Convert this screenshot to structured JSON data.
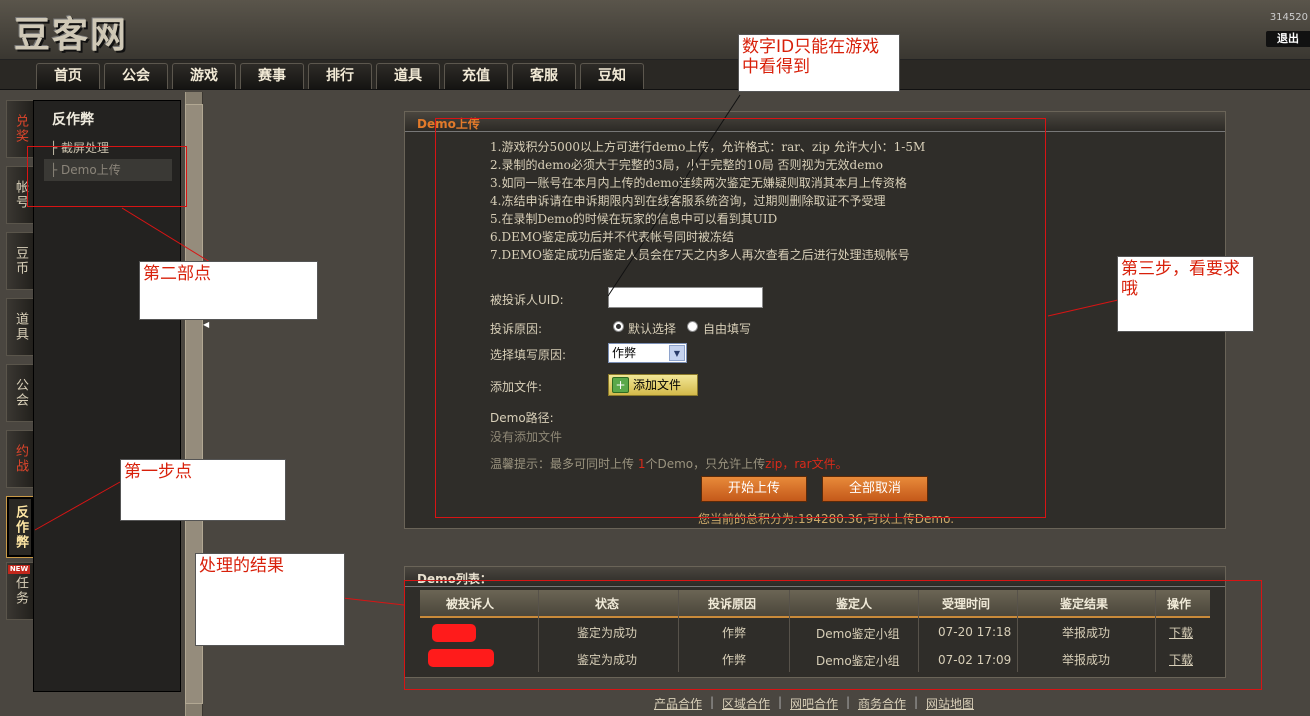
{
  "header": {
    "logo": "豆客网",
    "user_id_fragment": "314520",
    "logout_label": "退出"
  },
  "nav": {
    "items": [
      "首页",
      "公会",
      "游戏",
      "赛事",
      "排行",
      "道具",
      "充值",
      "客服",
      "豆知"
    ]
  },
  "left_tabs": {
    "items": [
      "兑奖",
      "帐号",
      "豆币",
      "道具",
      "公会",
      "约战",
      "反作弊",
      "任务"
    ],
    "new_badge": "NEW"
  },
  "side_panel": {
    "title": "反作弊",
    "links": [
      "截屏处理",
      "Demo上传"
    ]
  },
  "upload_box": {
    "title": "Demo上传",
    "rules": [
      "1.游戏积分5000以上方可进行demo上传，允许格式：rar、zip 允许大小：1-5M",
      "2.录制的demo必须大于完整的3局，小于完整的10局  否则视为无效demo",
      "3.如同一账号在本月内上传的demo连续两次鉴定无嫌疑则取消其本月上传资格",
      "4.冻结申诉请在申诉期限内到在线客服系统咨询，过期则删除取证不予受理",
      "5.在录制Demo的时候在玩家的信息中可以看到其UID",
      "6.DEMO鉴定成功后并不代表帐号同时被冻结",
      "7.DEMO鉴定成功后鉴定人员会在7天之内多人再次查看之后进行处理违规帐号"
    ],
    "uid_label": "被投诉人UID:",
    "uid_value": "",
    "reason_label": "投诉原因:",
    "radio_default": "默认选择",
    "radio_custom": "自由填写",
    "select_reason_label": "选择填写原因:",
    "select_value": "作弊",
    "add_file_label": "添加文件:",
    "add_file_button": "添加文件",
    "demo_path_label": "Demo路径:",
    "no_file_text": "没有添加文件",
    "hint_prefix": "温馨提示：最多可同时上传 ",
    "hint_count": "1",
    "hint_middle": "个Demo，只允许上传",
    "hint_formats": "zip，rar文件。",
    "start_upload_button": "开始上传",
    "cancel_all_button": "全部取消",
    "total_score_text": "您当前的总积分为:194280.36,可以上传Demo."
  },
  "list_box": {
    "title": "Demo列表：",
    "columns": [
      "被投诉人",
      "状态",
      "投诉原因",
      "鉴定人",
      "受理时间",
      "鉴定结果",
      "操作"
    ],
    "rows": [
      {
        "status": "鉴定为成功",
        "reason": "作弊",
        "judge": "Demo鉴定小组",
        "time": "07-20 17:18",
        "result": "举报成功",
        "action": "下载"
      },
      {
        "status": "鉴定为成功",
        "reason": "作弊",
        "judge": "Demo鉴定小组",
        "time": "07-02 17:09",
        "result": "举报成功",
        "action": "下载"
      }
    ]
  },
  "footer": {
    "links": [
      "产品合作",
      "区域合作",
      "网吧合作",
      "商务合作",
      "网站地图"
    ],
    "separator": "|"
  },
  "annotations": {
    "uid_note": "数字ID只能在游戏中看得到",
    "step2_note": "第二部点",
    "step3_note": "第三步，看要求哦",
    "step1_note": "第一步点",
    "result_note": "处理的结果"
  }
}
